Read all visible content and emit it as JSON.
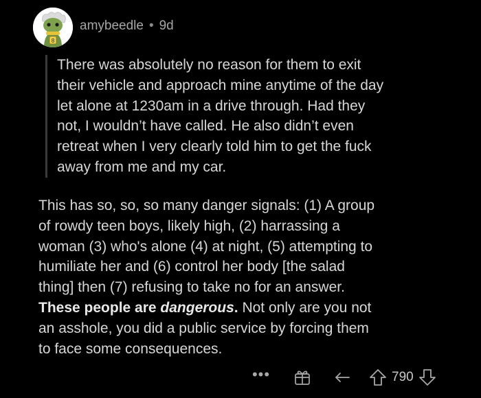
{
  "comment": {
    "username": "amybeedle",
    "separator": "•",
    "age": "9d",
    "avatar_icon": "avatar-frog-character-icon",
    "quote": {
      "line1": "There was absolutely no reason for them to exit",
      "line2": "their vehicle and approach mine anytime of the day",
      "line3": "let alone at 1230am in a drive through. Had they",
      "line4": "not, I wouldn’t have called. He also didn’t even",
      "line5": "retreat when I very clearly told him to get the fuck",
      "line6": "away from me and my car."
    },
    "body": {
      "line1": "This has so, so, so many danger signals: (1) A group",
      "line2": "of rowdy teen boys, likely high, (2) harrassing a",
      "line3": "woman (3) who's alone (4) at night, (5) attempting to",
      "line4": "humiliate her and (6) control her body [the salad",
      "line5": "thing] then (7) refusing to take no for an answer.",
      "line6_bold": "These people are ",
      "line6_bold_italic": "dangerous",
      "line6_bold_end": ".",
      "line6_rest": " Not only are you not",
      "line7": "an asshole, you did a public service by forcing them",
      "line8": "to face some consequences."
    },
    "actions": {
      "more_label": "•••",
      "score": "790",
      "icons": [
        "more-icon",
        "award-icon",
        "reply-icon",
        "upvote-icon",
        "downvote-icon"
      ]
    }
  },
  "colors": {
    "background": "#000000",
    "text": "#d7d7d7",
    "muted": "#a6a6a6",
    "quote_bar": "#3a3a3a"
  }
}
